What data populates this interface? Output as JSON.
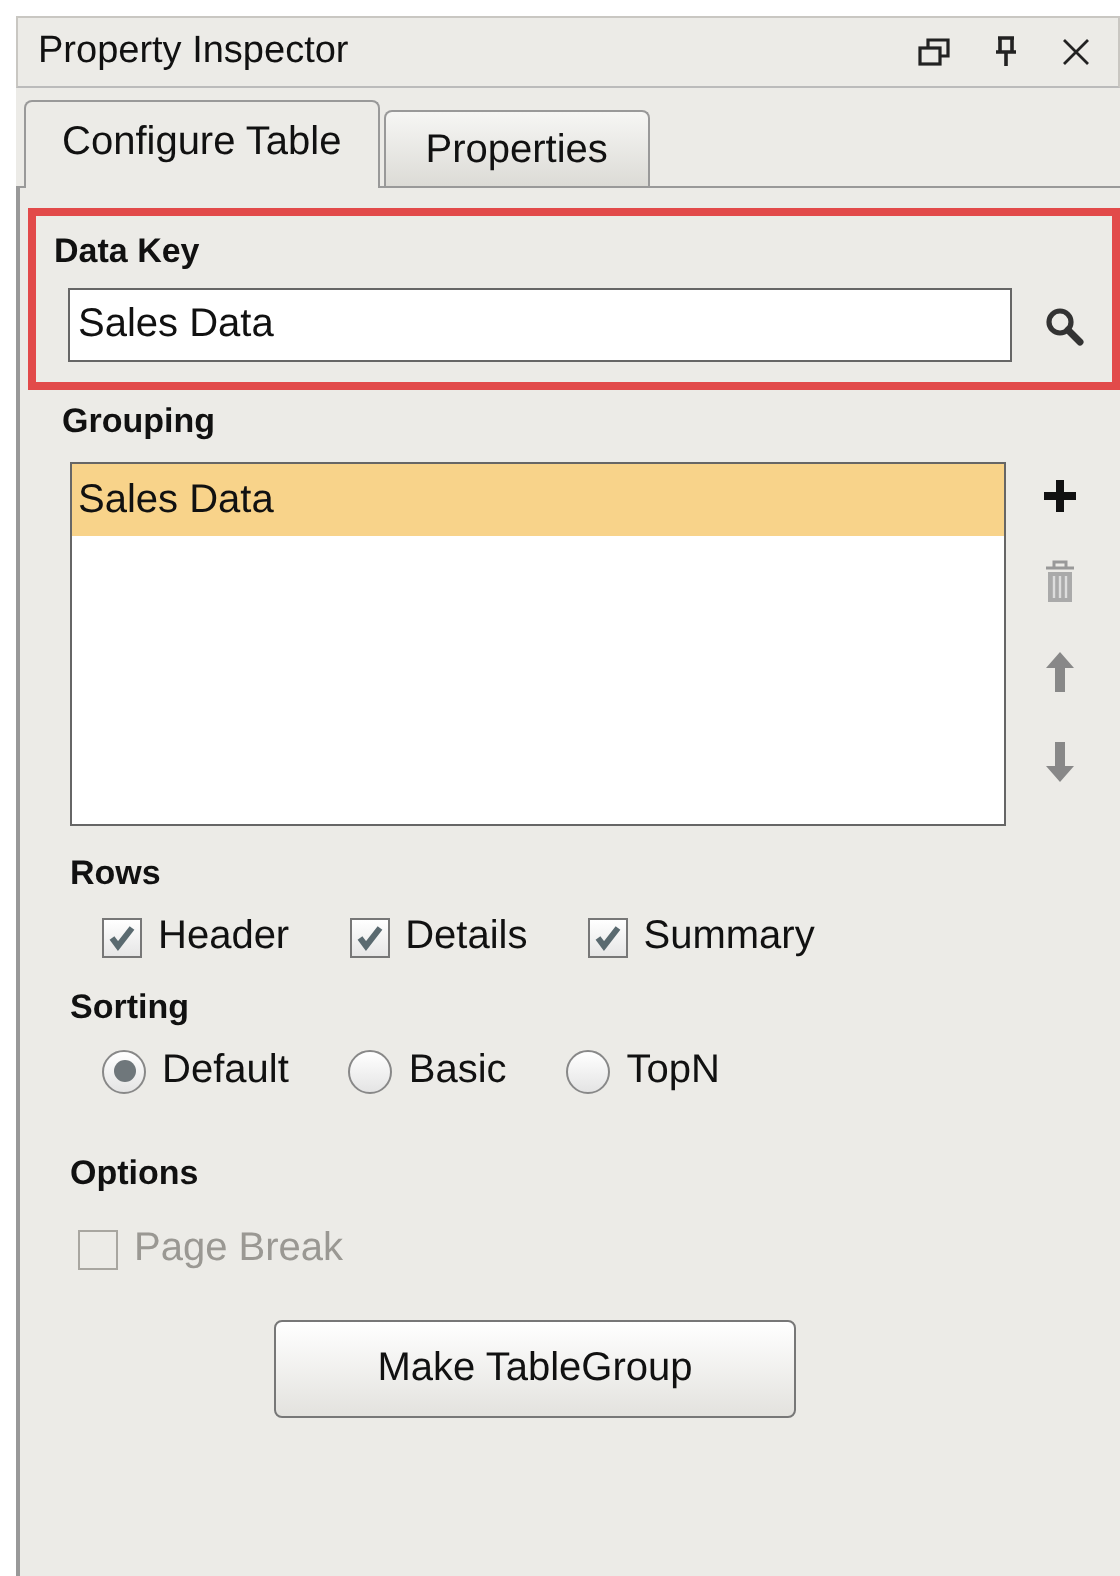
{
  "window": {
    "title": "Property Inspector"
  },
  "tabs": [
    {
      "label": "Configure Table",
      "selected": true
    },
    {
      "label": "Properties",
      "selected": false
    }
  ],
  "data_key": {
    "label": "Data Key",
    "value": "Sales Data",
    "highlighted": true
  },
  "grouping": {
    "label": "Grouping",
    "items": [
      {
        "label": "Sales Data",
        "selected": true
      }
    ]
  },
  "rows": {
    "label": "Rows",
    "options": [
      {
        "label": "Header",
        "checked": true
      },
      {
        "label": "Details",
        "checked": true
      },
      {
        "label": "Summary",
        "checked": true
      }
    ]
  },
  "sorting": {
    "label": "Sorting",
    "options": [
      {
        "label": "Default",
        "selected": true
      },
      {
        "label": "Basic",
        "selected": false
      },
      {
        "label": "TopN",
        "selected": false
      }
    ]
  },
  "options": {
    "label": "Options",
    "items": [
      {
        "label": "Page Break",
        "checked": false,
        "disabled": true
      }
    ]
  },
  "buttons": [
    "Make TableGroup"
  ]
}
